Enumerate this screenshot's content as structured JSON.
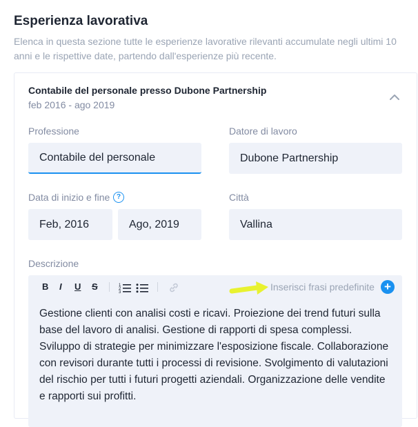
{
  "section": {
    "title": "Esperienza lavorativa",
    "description": "Elenca in questa sezione tutte le esperienze lavorative rilevanti accumulate negli ultimi 10 anni e le rispettive date, partendo dall'esperienze più recente."
  },
  "entry": {
    "title": "Contabile del personale presso Dubone Partnership",
    "dates": "feb 2016 - ago 2019",
    "collapse_icon": "chevron-up-icon"
  },
  "fields": {
    "profession_label": "Professione",
    "profession_value": "Contabile del personale",
    "employer_label": "Datore di lavoro",
    "employer_value": "Dubone Partnership",
    "dates_label": "Data di inizio e fine",
    "start_value": "Feb, 2016",
    "end_value": "Ago, 2019",
    "city_label": "Città",
    "city_value": "Vallina",
    "description_label": "Descrizione"
  },
  "editor": {
    "toolbar": {
      "bold": "B",
      "italic": "I",
      "underline": "U",
      "strike": "S"
    },
    "predefined_label": "Inserisci frasi predefinite",
    "plus_symbol": "+",
    "content": " Gestione clienti con analisi costi e ricavi. Proiezione dei trend futuri sulla base del lavoro di analisi. Gestione di rapporti di spesa complessi. Sviluppo di strategie per minimizzare l'esposizione fiscale. Collaborazione con revisori durante tutti i processi di revisione. Svolgimento di valutazioni del rischio per tutti i futuri progetti aziendali. Organizzazione delle vendite e rapporti sui profitti."
  },
  "colors": {
    "accent": "#1a91f0",
    "field_bg": "#eff2f9",
    "annotation_arrow": "#e8f230"
  }
}
